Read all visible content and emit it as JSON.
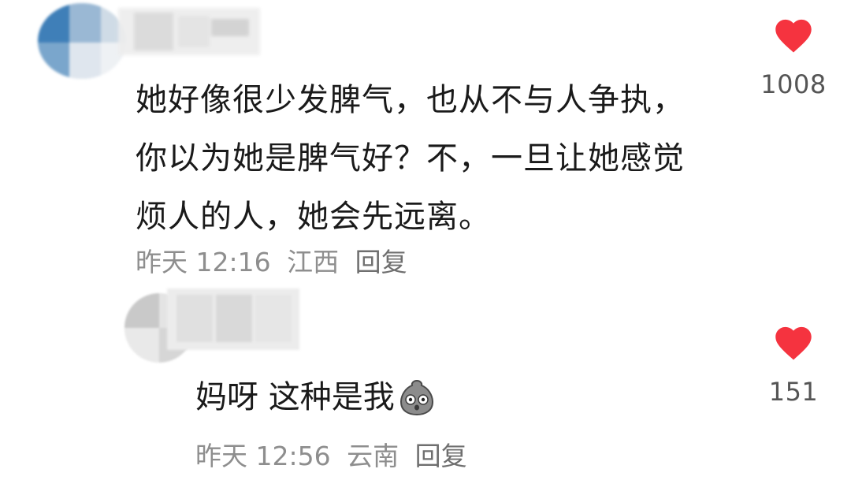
{
  "comment": {
    "text_lines": [
      "她好像很少发脾气，也从不与人争执，",
      "你以为她是脾气好？不，一旦让她感觉",
      "烦人的人，她会先远离。"
    ],
    "time": "昨天 12:16",
    "location": "江西",
    "reply_label": "回复",
    "like_count": "1008",
    "like_icon": "heart-icon",
    "like_color": "#F5333F"
  },
  "reply": {
    "text": "妈呀 这种是我",
    "emoji_icon": "shocked-face-emoji",
    "time": "昨天 12:56",
    "location": "云南",
    "reply_label": "回复",
    "like_count": "151",
    "like_icon": "heart-icon",
    "like_color": "#F5333F"
  }
}
